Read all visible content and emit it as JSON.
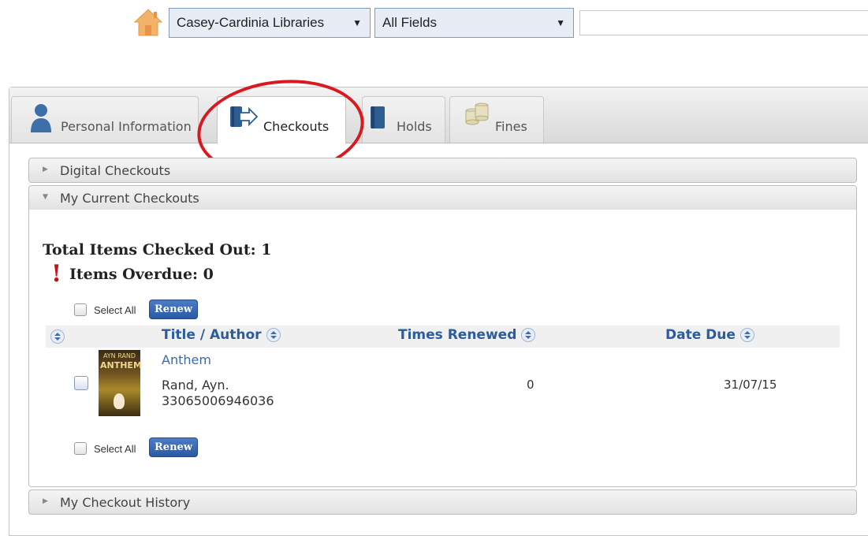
{
  "search": {
    "library_select": "Casey-Cardinia Libraries",
    "field_select": "All Fields",
    "query_value": ""
  },
  "tabs": [
    {
      "label": "Personal Information",
      "icon": "person-icon",
      "active": false
    },
    {
      "label": "Checkouts",
      "icon": "checkout-book-icon",
      "active": true
    },
    {
      "label": "Holds",
      "icon": "book-icon",
      "active": false
    },
    {
      "label": "Fines",
      "icon": "coins-icon",
      "active": false
    }
  ],
  "sections": {
    "digital": "Digital Checkouts",
    "current": "My Current Checkouts",
    "history": "My Checkout History"
  },
  "summary": {
    "total": "Total Items Checked Out: 1",
    "overdue": "Items Overdue: 0",
    "overdue_mark": "!"
  },
  "actions": {
    "select_all": "Select All",
    "renew": "Renew"
  },
  "table": {
    "columns": [
      "Title / Author",
      "Times Renewed",
      "Date Due"
    ],
    "rows": [
      {
        "title": "Anthem",
        "author": "Rand, Ayn.",
        "barcode": "33065006946036",
        "times_renewed": "0",
        "date_due": "31/07/15",
        "cover_text_top": "AYN RAND",
        "cover_text_title": "ANTHEM"
      }
    ]
  },
  "colors": {
    "accent": "#2a5c9e",
    "renew_button": "#2a5aa3",
    "annotation": "#d8191f",
    "overdue": "#c0141b"
  }
}
